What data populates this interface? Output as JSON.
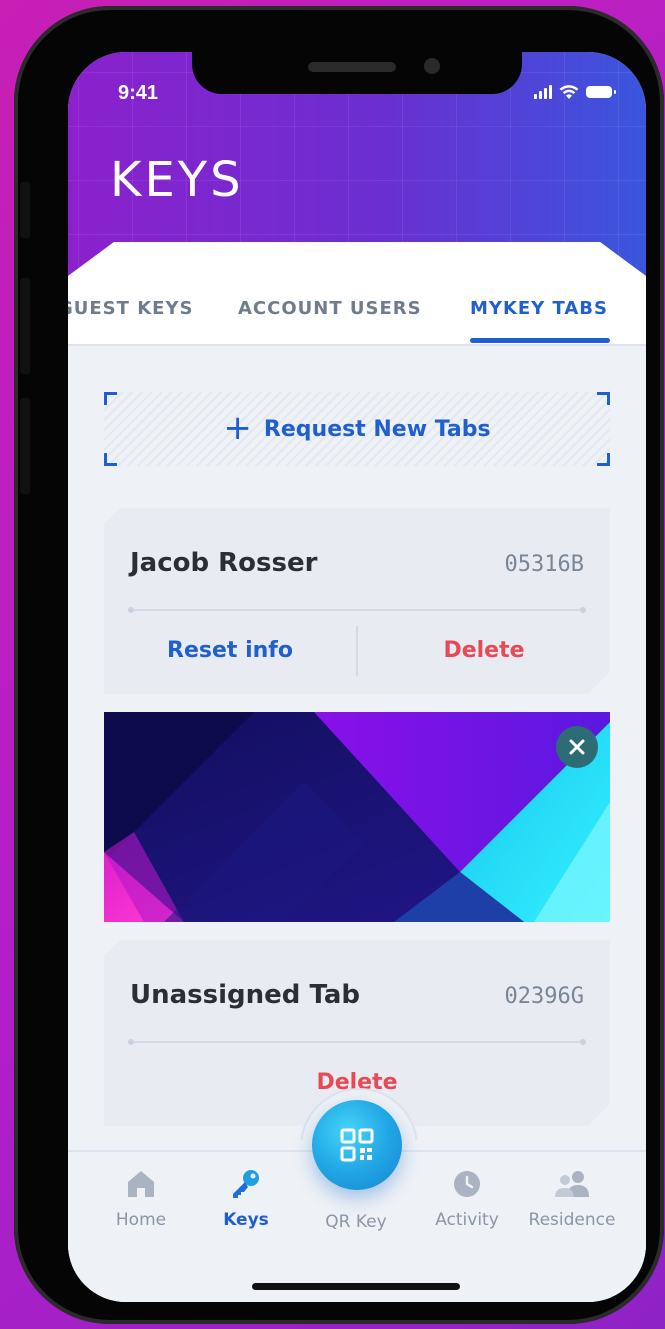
{
  "status": {
    "time": "9:41"
  },
  "header": {
    "title": "KEYS"
  },
  "tabs": [
    {
      "label": "GUEST KEYS",
      "active": false
    },
    {
      "label": "ACCOUNT USERS",
      "active": false
    },
    {
      "label": "MYKEY TABS",
      "active": true
    }
  ],
  "request": {
    "label": "Request New Tabs",
    "icon": "plus-icon"
  },
  "cards": [
    {
      "name": "Jacob Rosser",
      "code": "05316B",
      "primary_action": "Reset info",
      "secondary_action": "Delete"
    },
    {
      "name": "Unassigned Tab",
      "code": "02396G",
      "action": "Delete"
    }
  ],
  "banner": {
    "close_icon": "close-icon"
  },
  "tabbar": {
    "items": [
      {
        "label": "Home",
        "icon": "home-icon",
        "active": false
      },
      {
        "label": "Keys",
        "icon": "key-icon",
        "active": true
      },
      {
        "label": "QR Key",
        "icon": "qr-code-icon",
        "active": false
      },
      {
        "label": "Activity",
        "icon": "clock-icon",
        "active": false
      },
      {
        "label": "Residence",
        "icon": "people-icon",
        "active": false
      }
    ]
  },
  "colors": {
    "accent": "#1f5fcf",
    "danger": "#e84a55",
    "header_gradient_start": "#8b21cc",
    "header_gradient_end": "#3a56dd",
    "background": "#b21fc8"
  }
}
